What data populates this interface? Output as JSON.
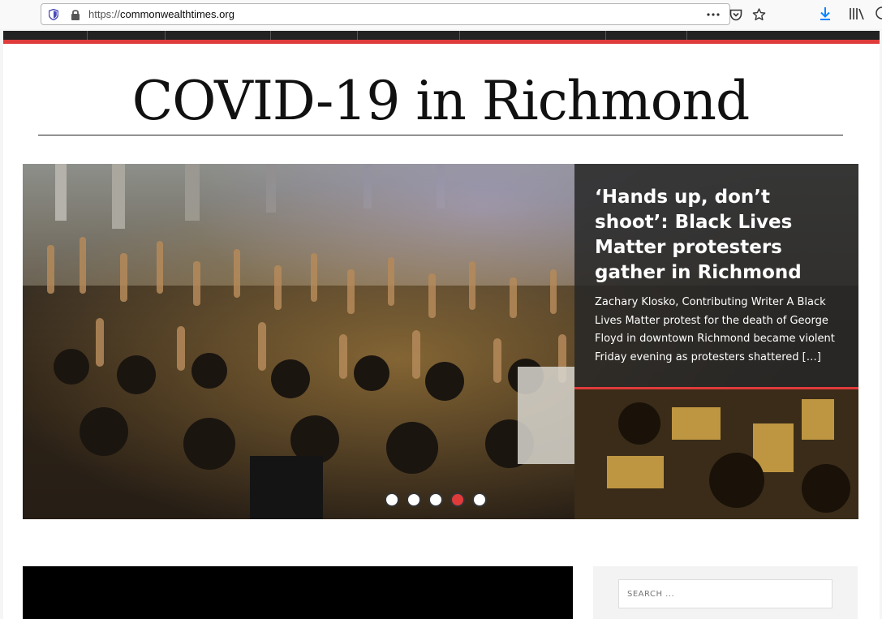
{
  "browser": {
    "url_scheme": "https://",
    "url_host": "commonwealthtimes.org",
    "more_icon": "ellipsis-icon",
    "pocket_icon": "pocket-icon",
    "bookmark_icon": "star-icon",
    "download_icon": "download-arrow-icon",
    "library_icon": "library-icon"
  },
  "site": {
    "banner_title": "COVID-19 in Richmond",
    "accent_color": "#e03b3b"
  },
  "slider": {
    "active_index": 3,
    "dot_count": 5,
    "slide": {
      "title": "‘Hands up, don’t shoot’: Black Lives Matter protesters gather in Richmond",
      "excerpt": "Zachary Klosko, Contributing Writer A Black Lives Matter protest for the death of George Floyd in downtown Richmond became violent Friday evening as protesters shattered […]"
    }
  },
  "sidebar": {
    "search_placeholder": "SEARCH ..."
  }
}
